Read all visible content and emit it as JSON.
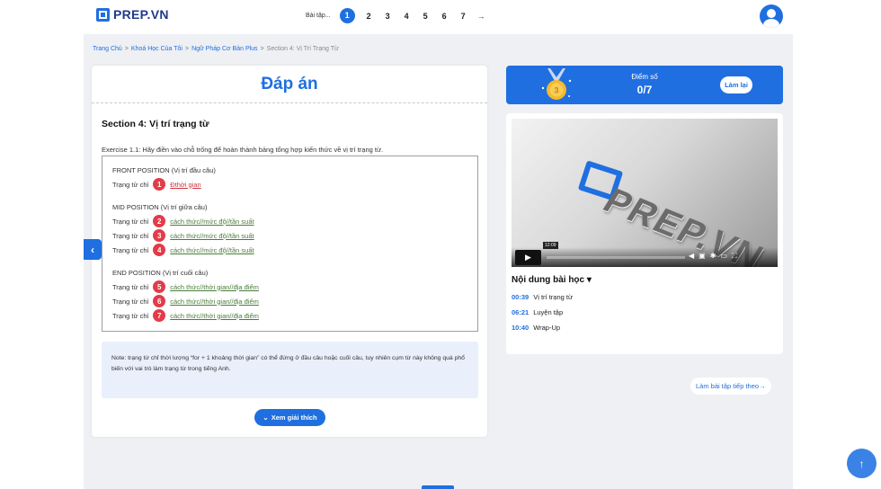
{
  "brand": {
    "name": "PREP.VN"
  },
  "exercise_nav": {
    "label": "Bài tập...",
    "pages": [
      "1",
      "2",
      "3",
      "4",
      "5",
      "6",
      "7"
    ],
    "active": "1",
    "next_arrow": "→"
  },
  "breadcrumb": [
    "Trang Chủ",
    "Khoá Học Của Tôi",
    "Ngữ Pháp Cơ Bản Plus",
    "Section 4: Vị Trí Trạng Từ"
  ],
  "breadcrumb_sep": ">",
  "answer_panel": {
    "title": "Đáp án",
    "section_title": "Section 4: Vị trí trạng từ",
    "exercise_text": "Exercise 1.1: Hãy điền vào chỗ trống để hoàn thành bảng tổng hợp kiến thức về vị trí trạng từ.",
    "groups": [
      {
        "title": "FRONT POSITION (Vị trí đầu câu)",
        "rows": [
          {
            "label": "Trạng từ chỉ",
            "num": "1",
            "value": "Đthời gian",
            "status": "wrong"
          }
        ]
      },
      {
        "title": "MID POSITION (Vị trí giữa câu)",
        "rows": [
          {
            "label": "Trạng từ chỉ",
            "num": "2",
            "value": "cách thức//mức độ//tần suất",
            "status": "correct"
          },
          {
            "label": "Trạng từ chỉ",
            "num": "3",
            "value": "cách thức//mức độ//tần suất",
            "status": "correct"
          },
          {
            "label": "Trạng từ chỉ",
            "num": "4",
            "value": "cách thức//mức độ//tần suất",
            "status": "correct"
          }
        ]
      },
      {
        "title": "END POSITION (Vị trí cuối câu)",
        "rows": [
          {
            "label": "Trạng từ chỉ",
            "num": "5",
            "value": "cách thức//thời gian//địa điểm",
            "status": "correct"
          },
          {
            "label": "Trạng từ chỉ",
            "num": "6",
            "value": "cách thức//thời gian//địa điểm",
            "status": "correct"
          },
          {
            "label": "Trạng từ chỉ",
            "num": "7",
            "value": "cách thức//thời gian//địa điểm",
            "status": "correct"
          }
        ]
      }
    ],
    "note": "Note: trạng từ chỉ thời lượng “for + 1 khoảng thời gian” có thể đứng ở đầu câu hoặc cuối câu, tuy nhiên cụm từ này không quá phổ biến với vai trò làm trạng từ trong tiếng Anh.",
    "explain_button": "Xem giải thích"
  },
  "score": {
    "label": "Điểm số",
    "value": "0/7",
    "redo_button": "Làm lại"
  },
  "video": {
    "brand_text": "PREP.VN",
    "time_tooltip": "12:09"
  },
  "lesson_content": {
    "title": "Nội dung bài học",
    "items": [
      {
        "time": "00:39",
        "name": "Vị trí trạng từ"
      },
      {
        "time": "06:21",
        "name": "Luyện tập"
      },
      {
        "time": "10:40",
        "name": "Wrap-Up"
      }
    ]
  },
  "next_exercise_link": "Làm bài tập tiếp theo",
  "colors": {
    "accent": "#1f6fe0",
    "badge": "#e23c4a",
    "wrong": "#d0343f",
    "correct": "#4a7c3a"
  }
}
